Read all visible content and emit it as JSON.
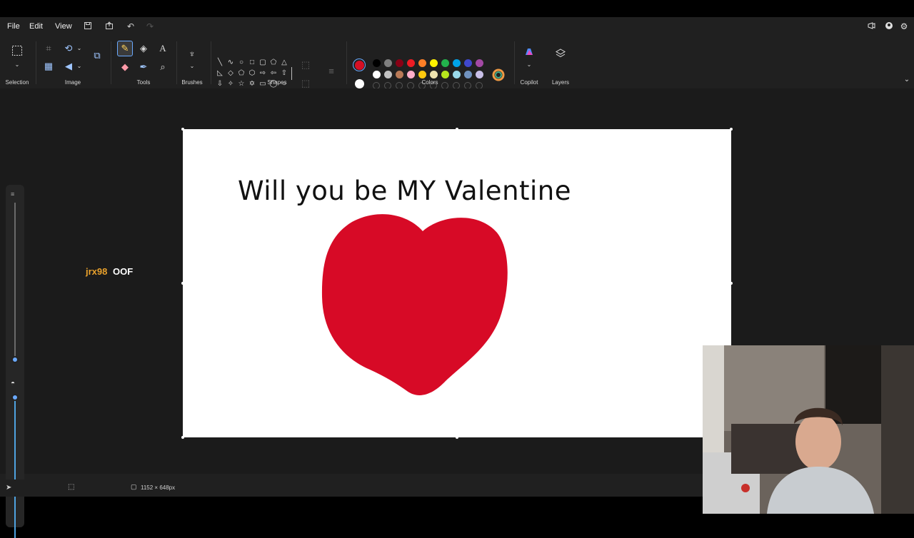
{
  "menu": {
    "file": "File",
    "edit": "Edit",
    "view": "View"
  },
  "ribbon": {
    "groups": {
      "selection": "Selection",
      "image": "Image",
      "tools": "Tools",
      "brushes": "Brushes",
      "shapes": "Shapes",
      "colors": "Colors",
      "copilot": "Copilot",
      "layers": "Layers"
    }
  },
  "colors": {
    "primary": "#d50f25",
    "secondary": "#ffffff",
    "row1": [
      "#000000",
      "#7f7f7f",
      "#880015",
      "#ed1c24",
      "#ff7f27",
      "#fff200",
      "#22b14c",
      "#00a2e8",
      "#3f48cc",
      "#a349a4"
    ],
    "row2": [
      "#ffffff",
      "#c3c3c3",
      "#b97a57",
      "#ffaec9",
      "#ffc90e",
      "#efe4b0",
      "#b5e61d",
      "#99d9ea",
      "#7092be",
      "#c8bfe7"
    ]
  },
  "canvas": {
    "text": "Will you be MY Valentine",
    "heart_color": "#d70a26"
  },
  "status": {
    "canvas_size": "1152 × 648px"
  },
  "overlay": {
    "user": "jrx98",
    "message": "OOF"
  }
}
